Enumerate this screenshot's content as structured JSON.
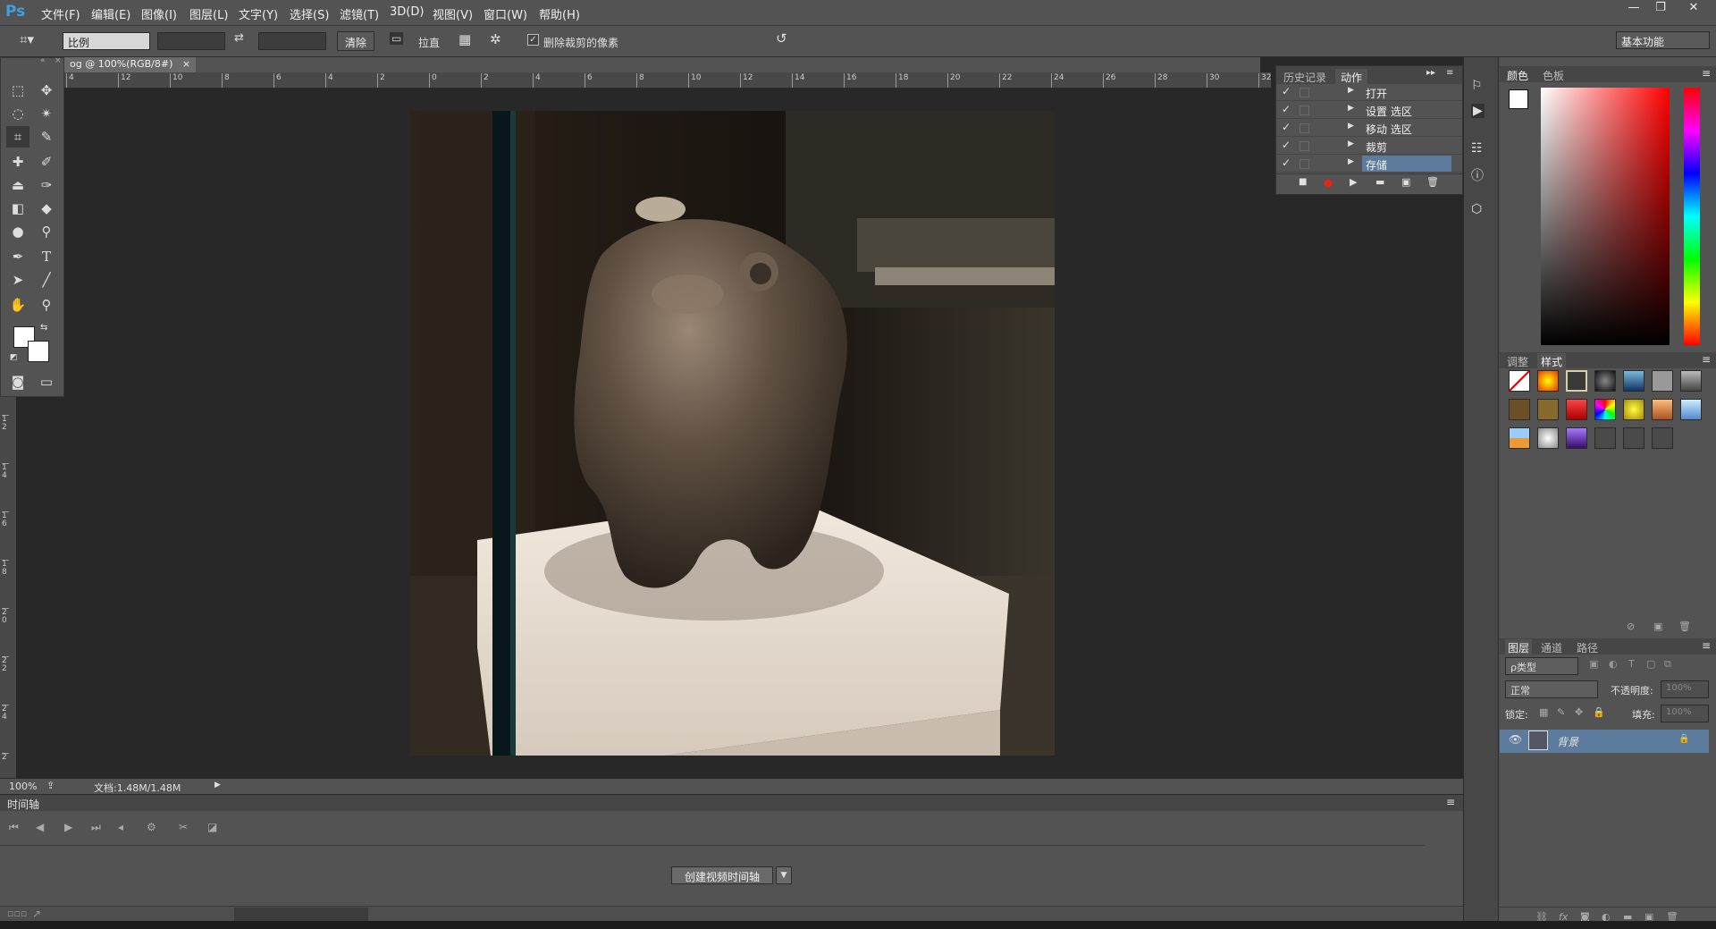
{
  "app": {
    "logo": "Ps"
  },
  "menus": [
    "文件(F)",
    "编辑(E)",
    "图像(I)",
    "图层(L)",
    "文字(Y)",
    "选择(S)",
    "滤镜(T)",
    "3D(D)",
    "视图(V)",
    "窗口(W)",
    "帮助(H)"
  ],
  "window_controls": {
    "minimize": "—",
    "restore": "❐",
    "close": "✕"
  },
  "options": {
    "ratio_label": "比例",
    "clear_button": "清除",
    "straighten_label": "拉直",
    "delete_cropped_label": "删除裁剪的像素",
    "delete_cropped_checked": true,
    "workspace": "基本功能"
  },
  "document": {
    "tab_title": "og @ 100%(RGB/8#)",
    "tab_close": "×",
    "zoom": "100%",
    "doc_info": "文档:1.48M/1.48M"
  },
  "ruler": {
    "h_labels": [
      "4",
      "12",
      "10",
      "8",
      "6",
      "4",
      "2",
      "0",
      "2",
      "4",
      "6",
      "8",
      "10",
      "12",
      "14",
      "16",
      "18",
      "20",
      "22",
      "24",
      "26",
      "28",
      "30",
      "32"
    ],
    "v_labels": [
      "1 2",
      "1 4",
      "1 6",
      "1 8",
      "2 0",
      "2 2",
      "2 4",
      "2"
    ]
  },
  "actions_panel": {
    "tabs": [
      "历史记录",
      "动作"
    ],
    "rows": [
      {
        "label": "打开",
        "checked": true
      },
      {
        "label": "设置 选区",
        "checked": true
      },
      {
        "label": "移动 选区",
        "checked": true
      },
      {
        "label": "裁剪",
        "checked": true
      },
      {
        "label": "存储",
        "checked": true,
        "selected": true
      }
    ]
  },
  "timeline": {
    "title": "时间轴",
    "create_button": "创建视频时间轴"
  },
  "color_panel": {
    "tabs": [
      "颜色",
      "色板"
    ],
    "foreground": "#ffffff",
    "background": "#ffffff"
  },
  "styles_panel": {
    "tabs": [
      "调整",
      "样式"
    ]
  },
  "layers_panel": {
    "tabs": [
      "图层",
      "通道",
      "路径"
    ],
    "filter_kind": "ρ类型",
    "blend_mode": "正常",
    "opacity_label": "不透明度:",
    "opacity_value": "100%",
    "lock_label": "锁定:",
    "fill_label": "填充:",
    "fill_value": "100%",
    "layers": [
      {
        "name": "背景",
        "visible": true,
        "locked": true
      }
    ]
  },
  "colors": {
    "accent": "#3ea0e0",
    "selection": "#5d7b9d",
    "record": "#e0271d"
  }
}
